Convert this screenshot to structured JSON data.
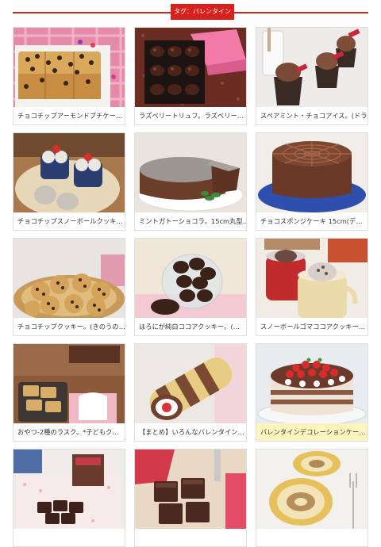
{
  "header": {
    "tag_label": "タグ：バレンタイン"
  },
  "colors": {
    "accent": "#d8201c",
    "highlight": "#fbf4bf"
  },
  "cards": [
    {
      "title": "チョコチップアーモンドブチケー…",
      "image": "chocolate-chip-cake-photo"
    },
    {
      "title": "ラズベリートリュフ。ラズベリー…",
      "image": "raspberry-truffles-box-photo"
    },
    {
      "title": "スペアミント・チョコアイス。(ドラ…",
      "image": "mint-chocolate-ice-cream-photo"
    },
    {
      "title": "チョコチップスノーボールクッキ…",
      "image": "snowball-cookies-photo"
    },
    {
      "title": "ミントガトーショコラ。15cm丸型…",
      "image": "mint-gateau-chocolat-photo"
    },
    {
      "title": "チョコスポンジケーキ 15cm(デ…",
      "image": "chocolate-sponge-cake-photo"
    },
    {
      "title": "チョコチップクッキー。(きのうの…",
      "image": "chocolate-chip-cookies-photo"
    },
    {
      "title": "ほろにが純白ココアクッキー。(…",
      "image": "cocoa-cookies-photo"
    },
    {
      "title": "スノーボールゴマココアクッキー…",
      "image": "sesame-cocoa-cookies-photo"
    },
    {
      "title": "おやつ-2種のラスク。*子どもク…",
      "image": "rusk-photo"
    },
    {
      "title": "【まとめ】いろんなバレンタイン…",
      "image": "roll-cake-photo"
    },
    {
      "title": "バレンタインデコレーションケー…",
      "image": "decoration-cake-photo"
    },
    {
      "title": "",
      "image": "chocolate-squares-photo"
    },
    {
      "title": "",
      "image": "brownies-photo"
    },
    {
      "title": "",
      "image": "swiss-roll-photo"
    }
  ]
}
